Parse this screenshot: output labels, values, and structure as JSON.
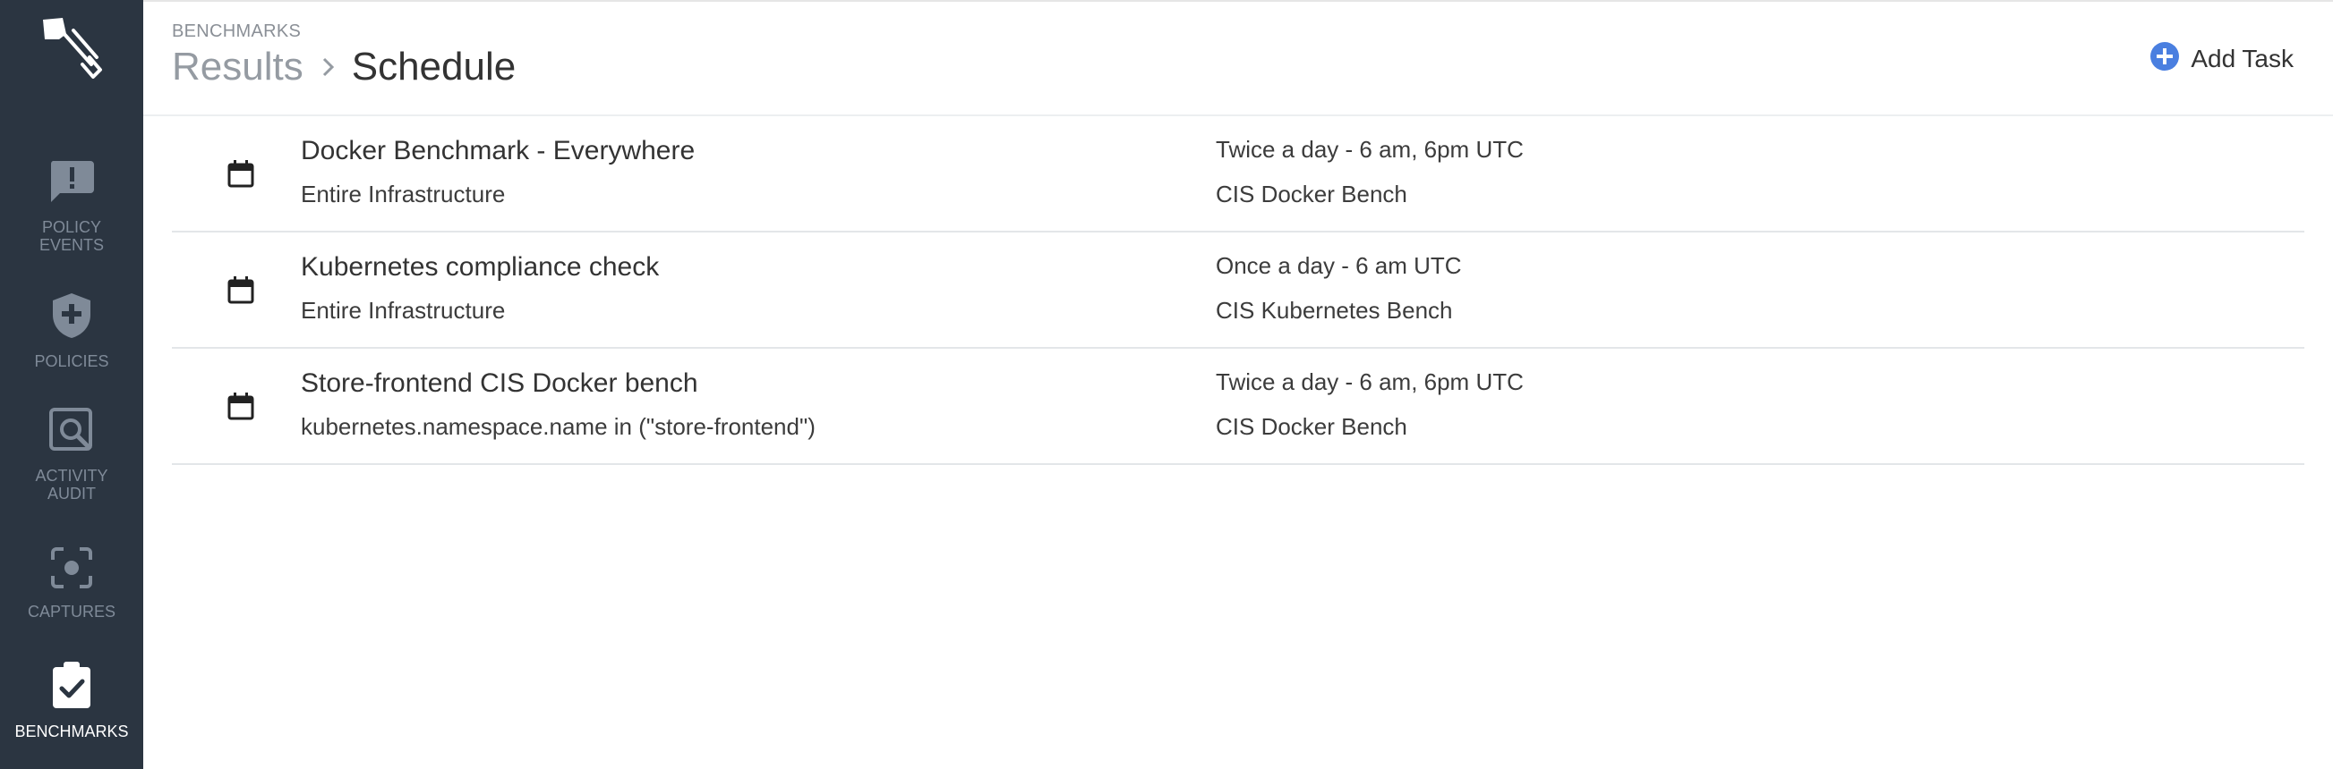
{
  "sidebar": {
    "items": [
      {
        "label": "POLICY\nEVENTS",
        "icon": "alert-message-icon"
      },
      {
        "label": "POLICIES",
        "icon": "shield-plus-icon"
      },
      {
        "label": "ACTIVITY\nAUDIT",
        "icon": "search-frame-icon"
      },
      {
        "label": "CAPTURES",
        "icon": "capture-frame-icon"
      },
      {
        "label": "BENCHMARKS",
        "icon": "clipboard-check-icon",
        "active": true
      }
    ]
  },
  "header": {
    "section": "BENCHMARKS",
    "breadcrumb": {
      "parent": "Results",
      "current": "Schedule"
    },
    "add_task_label": "Add Task"
  },
  "tasks": [
    {
      "name": "Docker Benchmark - Everywhere",
      "scope": "Entire Infrastructure",
      "schedule": "Twice a day - 6 am, 6pm UTC",
      "benchmark": "CIS Docker Bench"
    },
    {
      "name": "Kubernetes compliance check",
      "scope": "Entire Infrastructure",
      "schedule": "Once a day - 6 am UTC",
      "benchmark": "CIS Kubernetes Bench"
    },
    {
      "name": "Store-frontend CIS Docker bench",
      "scope": "kubernetes.namespace.name in (\"store-frontend\")",
      "schedule": "Twice a day - 6 am, 6pm UTC",
      "benchmark": "CIS Docker Bench"
    }
  ],
  "colors": {
    "sidebar_bg": "#2b3541",
    "sidebar_text": "#7f8a98",
    "active_text": "#ffffff",
    "accent": "#4a7fe0"
  }
}
